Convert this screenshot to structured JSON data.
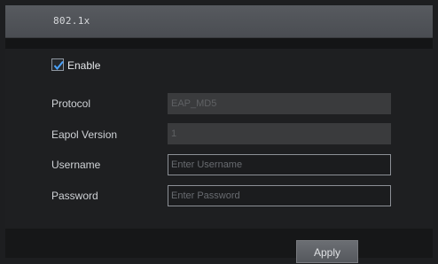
{
  "dialog": {
    "title": "802.1x"
  },
  "enable": {
    "label": "Enable",
    "checked": true
  },
  "form": {
    "protocol": {
      "label": "Protocol",
      "value": "EAP_MD5"
    },
    "eapol_version": {
      "label": "Eapol Version",
      "value": "1"
    },
    "username": {
      "label": "Username",
      "placeholder": "Enter Username"
    },
    "password": {
      "label": "Password",
      "placeholder": "Enter Password"
    }
  },
  "actions": {
    "apply_label": "Apply"
  },
  "colors": {
    "checkmark": "#4aa3ff",
    "background": "#1e1f21",
    "title_bar": "#55585d"
  },
  "icons": {
    "enable_checkbox": "check-icon"
  }
}
